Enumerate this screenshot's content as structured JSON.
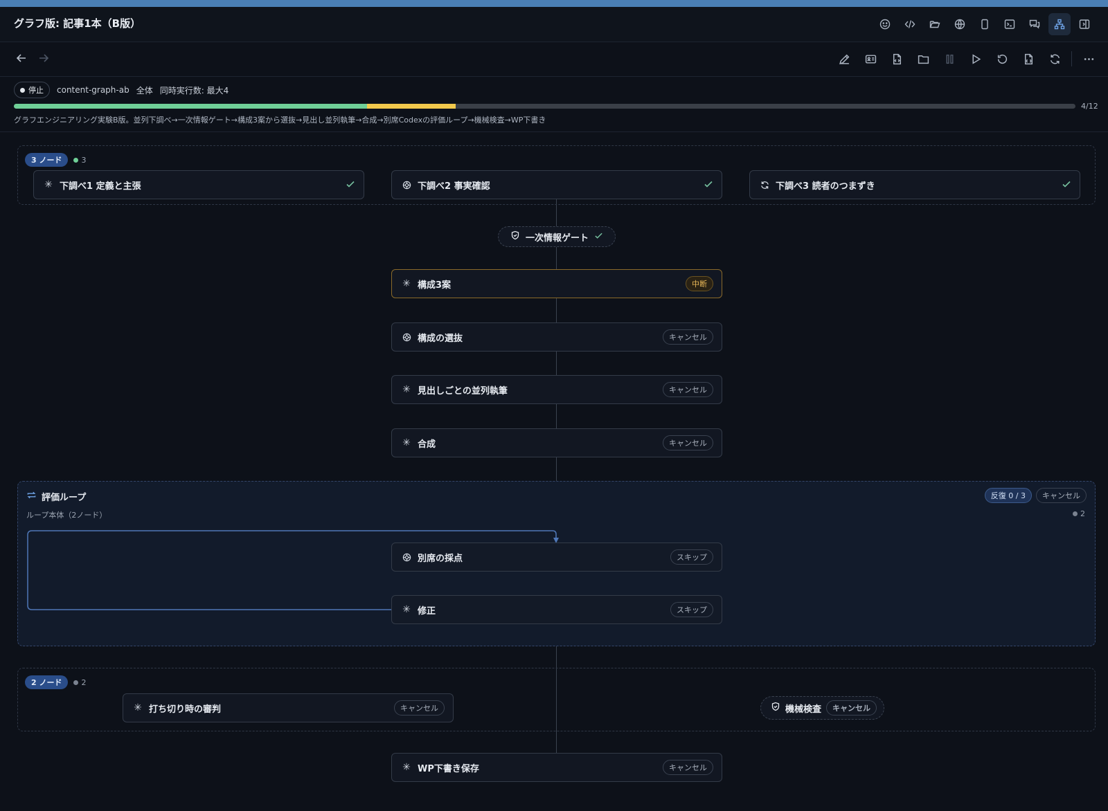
{
  "window": {
    "title": "グラフ版: 記事1本（B版）"
  },
  "titlebar_icons": [
    "smiley-icon",
    "code-icon",
    "folder-open-icon",
    "globe-icon",
    "phone-icon",
    "terminal-icon",
    "chat-icon",
    "graph-icon",
    "sidebar-icon"
  ],
  "toolbar_icons": [
    "pencil-icon",
    "id-card-icon",
    "file-code-icon",
    "folder-icon",
    "pause-icon",
    "play-icon",
    "undo-icon",
    "file-script-icon",
    "refresh-icon"
  ],
  "status": {
    "state": "停止",
    "workflow": "content-graph-ab",
    "scope": "全体",
    "concurrency": "同時実行数: 最大4"
  },
  "progress": {
    "label": "4/12",
    "completed_fraction": 0.333,
    "interrupted_fraction": 0.083,
    "colors": {
      "completed": "#6fcf97",
      "interrupted": "#f2c94c",
      "track": "#3a3f47"
    }
  },
  "description": "グラフエンジニアリング実験B版。並列下調べ→一次情報ゲート→構成3案から選抜→見出し並列執筆→合成→別席Codexの評価ループ→機械検査→WP下書き",
  "group1": {
    "badge": "3 ノード",
    "count": "3",
    "nodes": [
      {
        "label": "下調べ1 定義と主張",
        "icon": "claude-asterisk-icon",
        "status": "done"
      },
      {
        "label": "下調べ2 事実確認",
        "icon": "openai-icon",
        "status": "done"
      },
      {
        "label": "下調べ3 読者のつまずき",
        "icon": "cycle-icon",
        "status": "done"
      }
    ]
  },
  "gate": {
    "label": "一次情報ゲート",
    "status": "done"
  },
  "pipeline": [
    {
      "label": "構成3案",
      "icon": "claude-asterisk-icon",
      "status": "中断"
    },
    {
      "label": "構成の選抜",
      "icon": "openai-icon",
      "status": "キャンセル"
    },
    {
      "label": "見出しごとの並列執筆",
      "icon": "claude-asterisk-icon",
      "status": "キャンセル"
    },
    {
      "label": "合成",
      "icon": "claude-asterisk-icon",
      "status": "キャンセル"
    }
  ],
  "loop": {
    "title": "評価ループ",
    "subtitle": "ループ本体（2ノード）",
    "iteration": "反復 0 / 3",
    "status": "キャンセル",
    "count": "2",
    "nodes": [
      {
        "label": "別席の採点",
        "icon": "openai-icon",
        "status": "スキップ"
      },
      {
        "label": "修正",
        "icon": "claude-asterisk-icon",
        "status": "スキップ"
      }
    ]
  },
  "group2": {
    "badge": "2 ノード",
    "count": "2",
    "nodes": [
      {
        "label": "打ち切り時の審判",
        "icon": "claude-asterisk-icon",
        "status": "キャンセル"
      },
      {
        "label": "機械検査",
        "icon": "shield-icon",
        "status": "キャンセル"
      }
    ]
  },
  "final": {
    "label": "WP下書き保存",
    "icon": "claude-asterisk-icon",
    "status": "キャンセル"
  }
}
